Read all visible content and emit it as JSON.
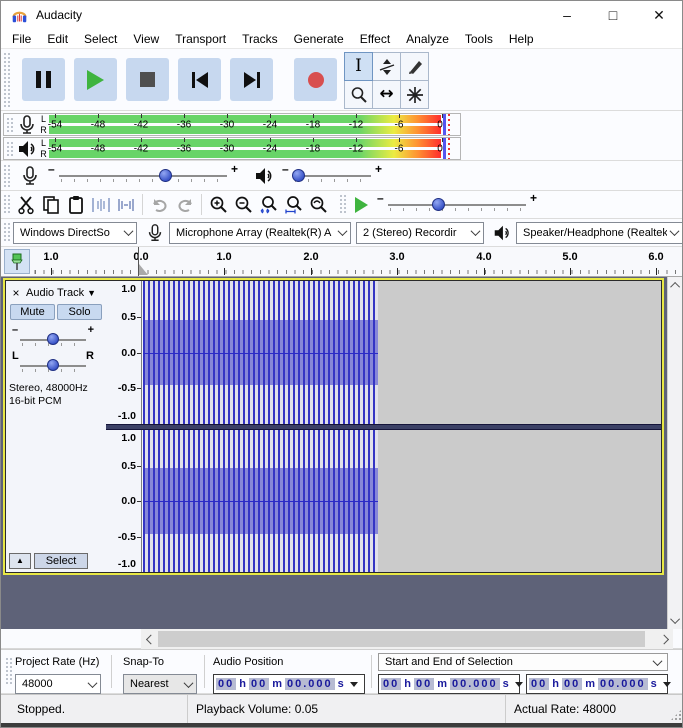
{
  "titlebar": {
    "title": "Audacity",
    "minimize": "–",
    "maximize": "□",
    "close": "✕"
  },
  "menubar": {
    "items": [
      "File",
      "Edit",
      "Select",
      "View",
      "Transport",
      "Tracks",
      "Generate",
      "Effect",
      "Analyze",
      "Tools",
      "Help"
    ]
  },
  "meters": {
    "scale": [
      "-54",
      "-48",
      "-42",
      "-36",
      "-30",
      "-24",
      "-18",
      "-12",
      "-6",
      "0"
    ],
    "channel_left": "L",
    "channel_right": "R"
  },
  "mixer": {
    "minus": "–",
    "plus": "+"
  },
  "device": {
    "host": "Windows DirectSo",
    "input": "Microphone Array (Realtek(R) A",
    "channels": "2 (Stereo) Recordir",
    "output": "Speaker/Headphone (Realtek(R)"
  },
  "timeline": {
    "labels": [
      "1.0",
      "0.0",
      "1.0",
      "2.0",
      "3.0",
      "4.0",
      "5.0",
      "6.0"
    ]
  },
  "track": {
    "close": "×",
    "name": "Audio Track",
    "caret": "▼",
    "mute": "Mute",
    "solo": "Solo",
    "minus": "–",
    "plus": "+",
    "left": "L",
    "right": "R",
    "info_line1": "Stereo, 48000Hz",
    "info_line2": "16-bit PCM",
    "collapse": "▲",
    "select": "Select",
    "vscale": [
      "1.0",
      "0.5",
      "0.0",
      "-0.5",
      "-1.0"
    ]
  },
  "selection": {
    "project_rate_label": "Project Rate (Hz)",
    "project_rate_value": "48000",
    "snap_label": "Snap-To",
    "snap_value": "Nearest",
    "audio_position_label": "Audio Position",
    "mode": "Start and End of Selection",
    "time": {
      "h": "00",
      "hu": "h",
      "m": "00",
      "mu": "m",
      "s": "00.000",
      "su": "s"
    }
  },
  "statusbar": {
    "status": "Stopped.",
    "playback_volume": "Playback Volume: 0.05",
    "actual_rate": "Actual Rate: 48000"
  }
}
